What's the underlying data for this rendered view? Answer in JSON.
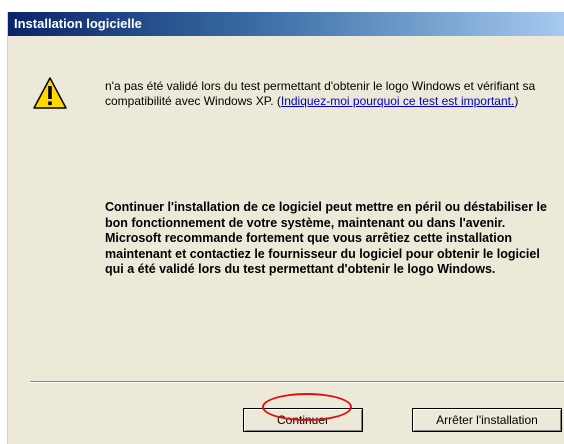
{
  "window": {
    "title": "Installation logicielle"
  },
  "message": {
    "line_text": "n'a pas été validé lors du test permettant d'obtenir le logo Windows et vérifiant sa compatibilité avec Windows XP. (",
    "link_text": "Indiquez-moi pourquoi ce test est important.",
    "after_link": ")",
    "warning": "Continuer l'installation de ce logiciel peut mettre en péril ou déstabiliser le bon fonctionnement de votre système, maintenant ou dans l'avenir. Microsoft recommande fortement que vous arrêtiez cette installation maintenant et contactiez le fournisseur du logiciel pour obtenir le logiciel qui a été validé lors du test permettant d'obtenir le logo Windows."
  },
  "buttons": {
    "continue_label": "Continuer",
    "stop_label": "Arrêter l'installation"
  },
  "icons": {
    "warning": "warning-icon"
  },
  "colors": {
    "title_gradient_start": "#0a246a",
    "title_gradient_end": "#a6caf0",
    "window_bg": "#ece9d8",
    "link": "#0000cc",
    "highlight_oval": "#e01010"
  }
}
